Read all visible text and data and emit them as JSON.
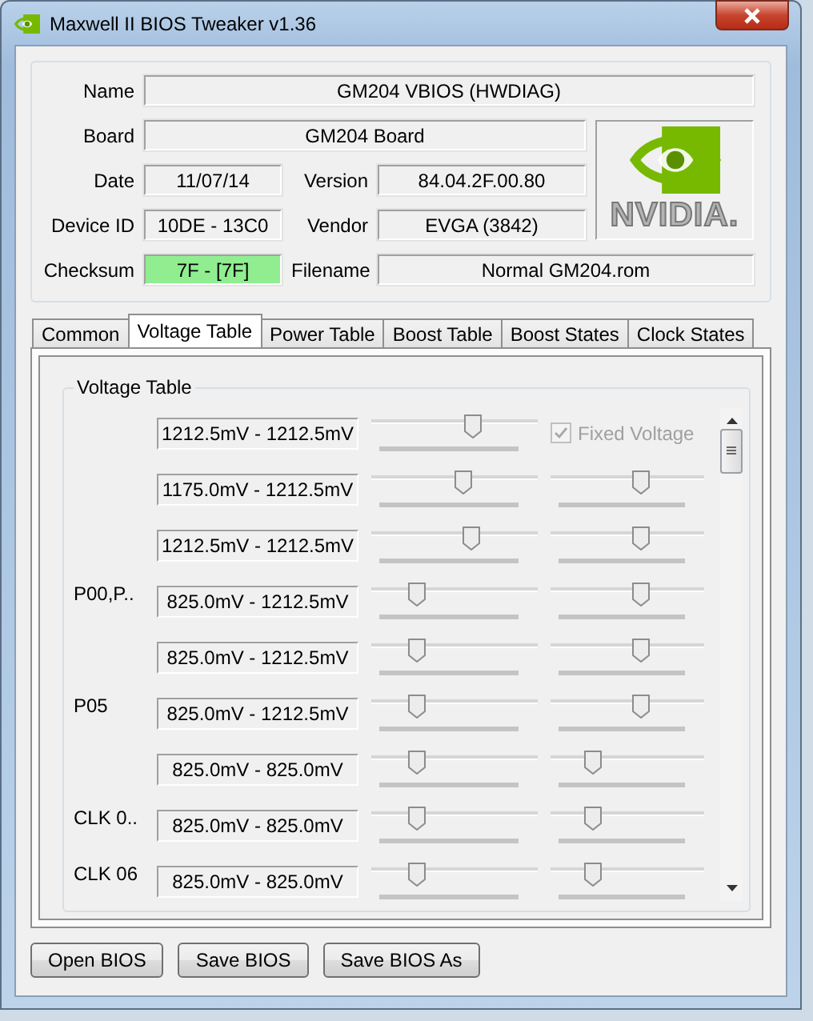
{
  "window": {
    "title": "Maxwell II BIOS Tweaker v1.36"
  },
  "info": {
    "name": {
      "label": "Name",
      "value": "GM204 VBIOS (HWDIAG)"
    },
    "board": {
      "label": "Board",
      "value": "GM204 Board"
    },
    "date": {
      "label": "Date",
      "value": "11/07/14"
    },
    "version": {
      "label": "Version",
      "value": "84.04.2F.00.80"
    },
    "device_id": {
      "label": "Device ID",
      "value": "10DE - 13C0"
    },
    "vendor": {
      "label": "Vendor",
      "value": "EVGA (3842)"
    },
    "checksum": {
      "label": "Checksum",
      "value": "7F - [7F]",
      "valid": true
    },
    "filename": {
      "label": "Filename",
      "value": "Normal GM204.rom"
    },
    "logo_text": "NVIDIA."
  },
  "tabs": [
    {
      "label": "Common",
      "selected": false
    },
    {
      "label": "Voltage Table",
      "selected": true
    },
    {
      "label": "Power Table",
      "selected": false
    },
    {
      "label": "Boost Table",
      "selected": false
    },
    {
      "label": "Boost States",
      "selected": false
    },
    {
      "label": "Clock States",
      "selected": false
    }
  ],
  "voltage_table": {
    "title": "Voltage Table",
    "rows": [
      {
        "range": "1212.5mV - 1212.5mV",
        "controls": [
          {
            "kind": "slider",
            "level": 0.62
          },
          {
            "kind": "checkbox",
            "label": "Fixed Voltage",
            "checked": true,
            "disabled": true
          }
        ]
      },
      {
        "range": "1175.0mV - 1212.5mV",
        "controls": [
          {
            "kind": "slider",
            "level": 0.56
          },
          {
            "kind": "slider",
            "level": 0.6
          }
        ]
      },
      {
        "range": "1212.5mV - 1212.5mV",
        "controls": [
          {
            "kind": "slider",
            "level": 0.61
          },
          {
            "kind": "slider",
            "level": 0.6
          }
        ]
      },
      {
        "label": "P00,P..",
        "range": "825.0mV - 1212.5mV",
        "controls": [
          {
            "kind": "slider",
            "level": 0.25
          },
          {
            "kind": "slider",
            "level": 0.6
          }
        ]
      },
      {
        "range": "825.0mV - 1212.5mV",
        "controls": [
          {
            "kind": "slider",
            "level": 0.25
          },
          {
            "kind": "slider",
            "level": 0.6
          }
        ]
      },
      {
        "label": "P05",
        "range": "825.0mV - 1212.5mV",
        "controls": [
          {
            "kind": "slider",
            "level": 0.25
          },
          {
            "kind": "slider",
            "level": 0.6
          }
        ]
      },
      {
        "range": "825.0mV - 825.0mV",
        "controls": [
          {
            "kind": "slider",
            "level": 0.25
          },
          {
            "kind": "slider",
            "level": 0.25
          }
        ]
      },
      {
        "label": "CLK 0..",
        "range": "825.0mV - 825.0mV",
        "controls": [
          {
            "kind": "slider",
            "level": 0.25
          },
          {
            "kind": "slider",
            "level": 0.25
          }
        ]
      },
      {
        "label": "CLK 06",
        "range": "825.0mV - 825.0mV",
        "controls": [
          {
            "kind": "slider",
            "level": 0.25
          },
          {
            "kind": "slider",
            "level": 0.25
          }
        ]
      }
    ]
  },
  "buttons": [
    "Open BIOS",
    "Save BIOS",
    "Save BIOS As"
  ]
}
